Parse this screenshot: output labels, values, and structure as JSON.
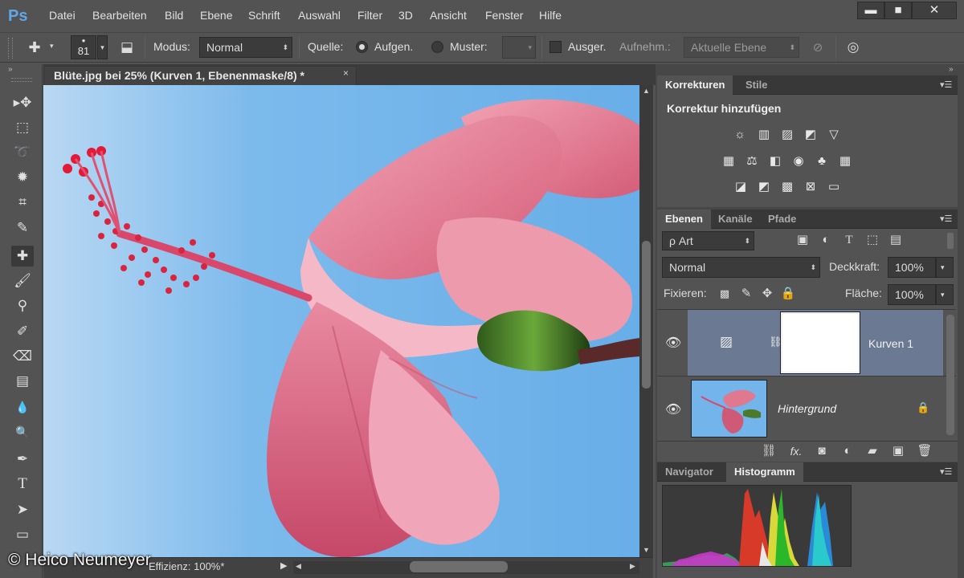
{
  "app": {
    "logo": "Ps"
  },
  "menu": [
    "Datei",
    "Bearbeiten",
    "Bild",
    "Ebene",
    "Schrift",
    "Auswahl",
    "Filter",
    "3D",
    "Ansicht",
    "Fenster",
    "Hilfe"
  ],
  "window_buttons": {
    "minimize": "▬",
    "maximize": "■",
    "close": "✕"
  },
  "options": {
    "brush_size": "81",
    "modus_label": "Modus:",
    "modus_value": "Normal",
    "quelle_label": "Quelle:",
    "aufgen_label": "Aufgen.",
    "muster_label": "Muster:",
    "ausger_label": "Ausger.",
    "aufnehm_label": "Aufnehm.:",
    "aufnehm_value": "Aktuelle Ebene"
  },
  "tools": [
    {
      "name": "move-tool-icon",
      "glyph": "▸✥"
    },
    {
      "name": "marquee-tool-icon",
      "glyph": "⬚"
    },
    {
      "name": "lasso-tool-icon",
      "glyph": "➰"
    },
    {
      "name": "magic-wand-tool-icon",
      "glyph": "✹"
    },
    {
      "name": "crop-tool-icon",
      "glyph": "⌗"
    },
    {
      "name": "eyedropper-tool-icon",
      "glyph": "✎"
    },
    {
      "name": "healing-brush-tool-icon",
      "glyph": "✚"
    },
    {
      "name": "brush-tool-icon",
      "glyph": "🖌"
    },
    {
      "name": "clone-stamp-tool-icon",
      "glyph": "⚲"
    },
    {
      "name": "history-brush-tool-icon",
      "glyph": "✐"
    },
    {
      "name": "eraser-tool-icon",
      "glyph": "⌫"
    },
    {
      "name": "gradient-tool-icon",
      "glyph": "▤"
    },
    {
      "name": "blur-tool-icon",
      "glyph": "💧"
    },
    {
      "name": "dodge-tool-icon",
      "glyph": "🔍"
    },
    {
      "name": "pen-tool-icon",
      "glyph": "✒"
    },
    {
      "name": "type-tool-icon",
      "glyph": "T"
    },
    {
      "name": "path-selection-tool-icon",
      "glyph": "➤"
    },
    {
      "name": "shape-tool-icon",
      "glyph": "▭"
    }
  ],
  "document": {
    "tab_title": "Blüte.jpg bei 25% (Kurven 1, Ebenenmaske/8) *",
    "tab_close": "×",
    "status_text": "Effizienz: 100%*",
    "zoom": "25%"
  },
  "watermark": "© Heico Neumeyer",
  "corrections_panel": {
    "tabs": [
      "Korrekturen",
      "Stile"
    ],
    "heading": "Korrektur hinzufügen"
  },
  "layers_panel": {
    "tabs": [
      "Ebenen",
      "Kanäle",
      "Pfade"
    ],
    "filter_value": "ρ Art",
    "blend_mode": "Normal",
    "opacity_label": "Deckkraft:",
    "opacity_value": "100%",
    "lock_label": "Fixieren:",
    "fill_label": "Fläche:",
    "fill_value": "100%",
    "layers": [
      {
        "name": "Kurven 1",
        "selected": true
      },
      {
        "name": "Hintergrund",
        "selected": false
      }
    ]
  },
  "histogram_panel": {
    "tabs": [
      "Navigator",
      "Histogramm"
    ]
  },
  "colors": {
    "sky": "#6fb3ea",
    "petal": "#e0788f",
    "accent_blue": "#5fa8e8"
  }
}
